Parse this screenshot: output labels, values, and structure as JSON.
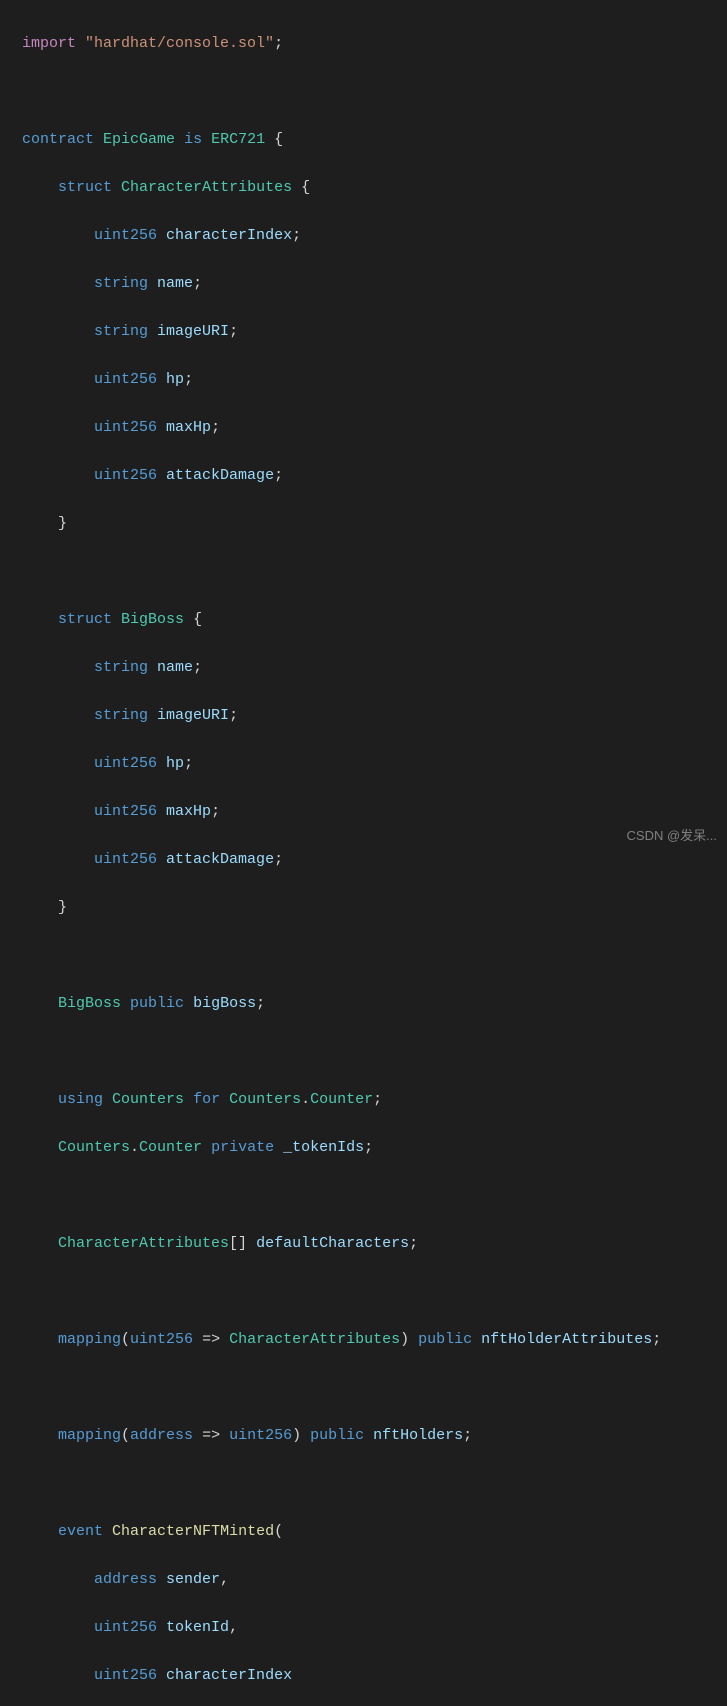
{
  "code": {
    "l1_import": "import",
    "l1_str": "\"hardhat/console.sol\"",
    "l1_semi": ";",
    "l3_contract": "contract",
    "l3_name": "EpicGame",
    "l3_is": "is",
    "l3_base": "ERC721",
    "l3_brace": " {",
    "l4_struct": "struct",
    "l4_name": "CharacterAttributes",
    "l4_brace": " {",
    "l5_type": "uint256",
    "l5_name": "characterIndex",
    "l5_semi": ";",
    "l6_type": "string",
    "l6_name": "name",
    "l6_semi": ";",
    "l7_type": "string",
    "l7_name": "imageURI",
    "l7_semi": ";",
    "l8_type": "uint256",
    "l8_name": "hp",
    "l8_semi": ";",
    "l9_type": "uint256",
    "l9_name": "maxHp",
    "l9_semi": ";",
    "l10_type": "uint256",
    "l10_name": "attackDamage",
    "l10_semi": ";",
    "l11_brace": "}",
    "l13_struct": "struct",
    "l13_name": "BigBoss",
    "l13_brace": " {",
    "l14_type": "string",
    "l14_name": "name",
    "l14_semi": ";",
    "l15_type": "string",
    "l15_name": "imageURI",
    "l15_semi": ";",
    "l16_type": "uint256",
    "l16_name": "hp",
    "l16_semi": ";",
    "l17_type": "uint256",
    "l17_name": "maxHp",
    "l17_semi": ";",
    "l18_type": "uint256",
    "l18_name": "attackDamage",
    "l18_semi": ";",
    "l19_brace": "}",
    "l21_type": "BigBoss",
    "l21_vis": "public",
    "l21_name": "bigBoss",
    "l21_semi": ";",
    "l23_using": "using",
    "l23_lib": "Counters",
    "l23_for": "for",
    "l23_target": "Counters",
    "l23_dot": ".",
    "l23_target2": "Counter",
    "l23_semi": ";",
    "l24_type": "Counters",
    "l24_dot": ".",
    "l24_type2": "Counter",
    "l24_vis": "private",
    "l24_name": "_tokenIds",
    "l24_semi": ";",
    "l26_type": "CharacterAttributes",
    "l26_arr": "[]",
    "l26_name": "defaultCharacters",
    "l26_semi": ";",
    "l28_map": "mapping",
    "l28_open": "(",
    "l28_k": "uint256",
    "l28_arrow": " => ",
    "l28_v": "CharacterAttributes",
    "l28_close": ")",
    "l28_vis": "public",
    "l28_name": "nftHolderAttributes",
    "l28_semi": ";",
    "l30_map": "mapping",
    "l30_open": "(",
    "l30_k": "address",
    "l30_arrow": " => ",
    "l30_v": "uint256",
    "l30_close": ")",
    "l30_vis": "public",
    "l30_name": "nftHolders",
    "l30_semi": ";",
    "l32_event": "event",
    "l32_name": "CharacterNFTMinted",
    "l32_open": "(",
    "l33_type": "address",
    "l33_name": "sender",
    "l33_comma": ",",
    "l34_type": "uint256",
    "l34_name": "tokenId",
    "l34_comma": ",",
    "l35_type": "uint256",
    "l35_name": "characterIndex"
  },
  "watermark": "CSDN @发呆..."
}
